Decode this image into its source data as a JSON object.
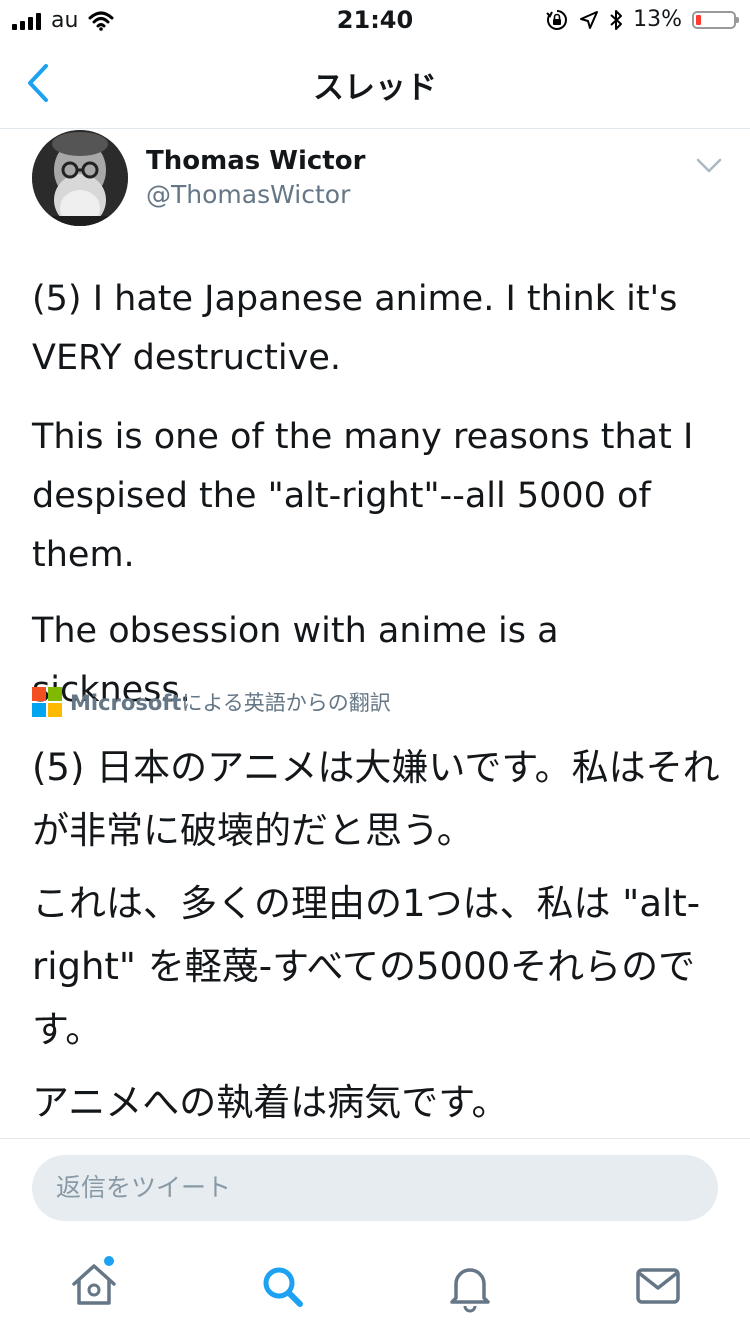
{
  "status_bar": {
    "carrier": "au",
    "time": "21:40",
    "battery_percent": "13%",
    "battery_level": 0.13,
    "battery_color": "#ff3b30"
  },
  "nav": {
    "title": "スレッド",
    "back_icon": "chevron-left-icon"
  },
  "tweet": {
    "author_name": "Thomas Wictor",
    "author_handle": "@ThomasWictor",
    "menu_icon": "chevron-down-icon",
    "paragraphs": [
      "(5) I hate Japanese anime. I think it's VERY destructive.",
      "This is one of the many reasons that I despised the \"alt-right\"--all 5000 of them.",
      "The obsession with anime is a sickness."
    ],
    "translation_brand": "Microsoft",
    "translation_label": "による英語からの翻訳",
    "translated_paragraphs": [
      "(5) 日本のアニメは大嫌いです。私はそれが非常に破壊的だと思う。",
      "これは、多くの理由の1つは、私は \"alt-right\" を軽蔑-すべての5000それらのです。",
      "アニメへの執着は病気です。"
    ]
  },
  "reply": {
    "placeholder": "返信をツイート"
  },
  "tab_bar": {
    "items": [
      "home-icon",
      "search-icon",
      "notifications-icon",
      "messages-icon"
    ],
    "active": "search-icon"
  },
  "colors": {
    "accent": "#1da1f2",
    "secondary_text": "#657786",
    "ms_red": "#f25022",
    "ms_green": "#7fba00",
    "ms_blue": "#00a4ef",
    "ms_yellow": "#ffb900"
  }
}
